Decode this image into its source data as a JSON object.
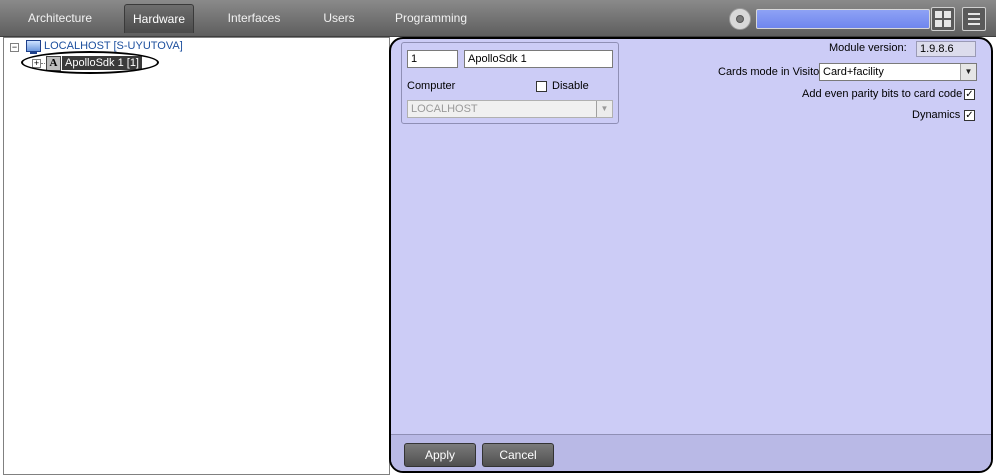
{
  "nav": {
    "tabs": [
      {
        "label": "Architecture"
      },
      {
        "label": "Hardware"
      },
      {
        "label": "Interfaces"
      },
      {
        "label": "Users"
      },
      {
        "label": "Programming"
      }
    ],
    "active_tab": "Hardware",
    "search_value": ""
  },
  "tree": {
    "root_label": "LOCALHOST [S-UYUTOVA]",
    "child_label": "ApolloSdk 1 [1]",
    "child_icon_letter": "A"
  },
  "props": {
    "id_value": "1",
    "name_value": "ApolloSdk 1",
    "computer_label": "Computer",
    "disable_label": "Disable",
    "disable_checked": false,
    "computer_value": "LOCALHOST",
    "module_version_label": "Module version:",
    "module_version_value": "1.9.8.6",
    "cards_mode_label": "Cards mode in Visitor",
    "cards_mode_value": "Card+facility",
    "even_parity_label": "Add even parity bits to card code",
    "even_parity_checked": true,
    "dynamics_label": "Dynamics",
    "dynamics_checked": true
  },
  "footer": {
    "apply_label": "Apply",
    "cancel_label": "Cancel"
  },
  "colors": {
    "panel_bg": "#ccccf6",
    "topbar": "#6e6e6e",
    "search_field": "#7f94f1"
  }
}
